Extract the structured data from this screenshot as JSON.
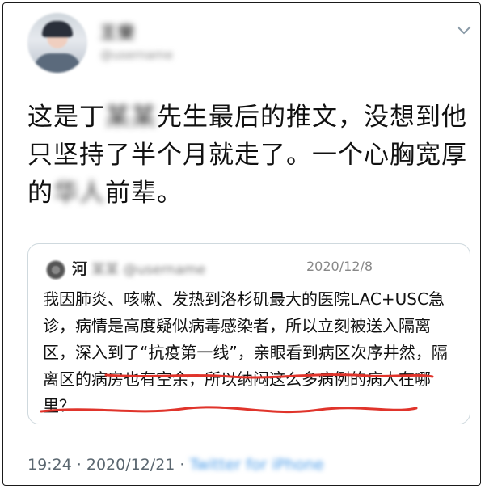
{
  "tweet": {
    "name_placeholder": "王斐",
    "handle_placeholder": "@username",
    "text_part1": "这是丁",
    "text_blur1": "某某",
    "text_part2": "先生最后的推文，没想到他只坚持了半个月就走了。一个心胸宽厚的",
    "text_blur2": "华人",
    "text_part3": "前辈。"
  },
  "quoted": {
    "name": "河",
    "name_blur": "某某 @username",
    "date": "2020/12/8",
    "text": "我因肺炎、咳嗽、发热到洛杉矶最大的医院LAC+USC急诊，病情是高度疑似病毒感染者，所以立刻被送入隔离区，深入到了“抗疫第一线”，亲眼看到病区次序井然，隔离区的病房也有空余，所以纳闷这么多病例的病人在哪里？"
  },
  "footer": {
    "time": "19:24 · 2020/12/21 ·",
    "source_blur": "Twitter for iPhone"
  },
  "colors": {
    "underline": "#e0342b",
    "border": "#cfd9de"
  },
  "icons": {
    "menu": "chevron-down-icon"
  }
}
